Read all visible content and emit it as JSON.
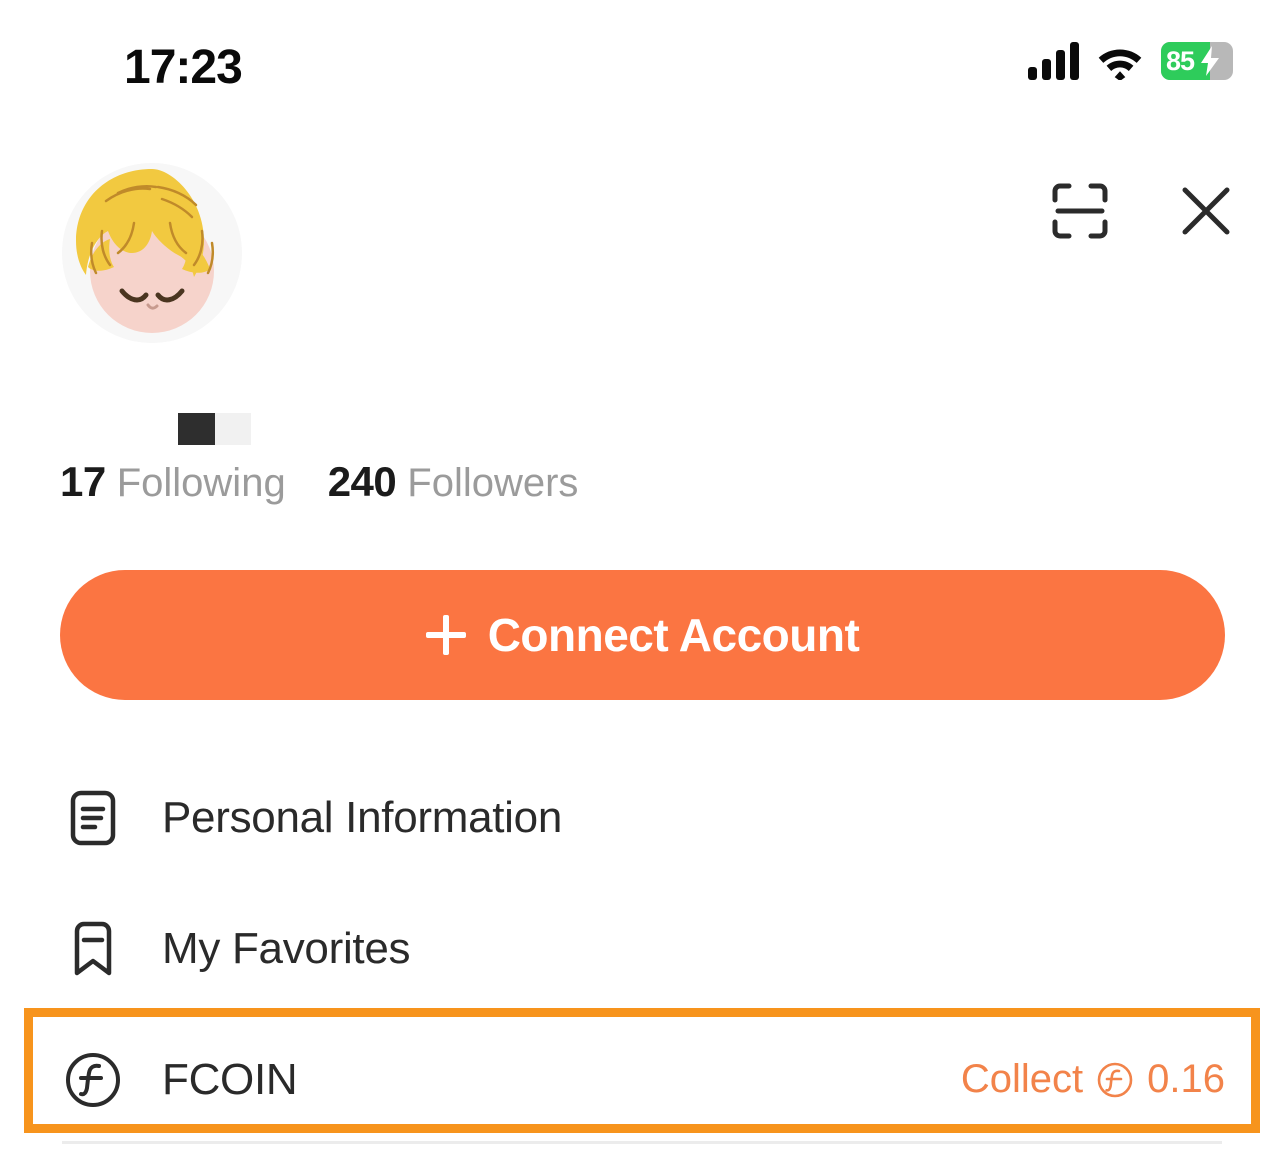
{
  "status_bar": {
    "time": "17:23",
    "signal_icon": "cellular-signal-icon",
    "wifi_icon": "wifi-icon",
    "battery": {
      "percent_label": "85",
      "percent_value": 85,
      "charging": true,
      "fill_color": "#2ecc5b"
    }
  },
  "header": {
    "avatar_name": "user-avatar",
    "scan_icon": "scan-qr-icon",
    "close_icon": "close-icon"
  },
  "profile": {
    "username_redacted": true,
    "stats": [
      {
        "count": "17",
        "label": "Following"
      },
      {
        "count": "240",
        "label": "Followers"
      }
    ]
  },
  "connect": {
    "label": "Connect Account",
    "plus_icon": "plus-icon",
    "background_color": "#fb7542",
    "text_color": "#ffffff"
  },
  "menu": {
    "items": [
      {
        "label": "Personal Information",
        "icon": "document-lines-icon",
        "trailing": null,
        "highlighted": false
      },
      {
        "label": "My Favorites",
        "icon": "bookmark-minus-icon",
        "trailing": null,
        "highlighted": false
      },
      {
        "label": "FCOIN",
        "icon": "fcoin-circle-icon",
        "trailing": {
          "action_label": "Collect",
          "coin_icon": "fcoin-small-icon",
          "amount": "0.16",
          "color": "#f2834a"
        },
        "highlighted": true
      }
    ]
  },
  "highlight": {
    "border_color": "#f7941d",
    "target": "FCOIN"
  }
}
